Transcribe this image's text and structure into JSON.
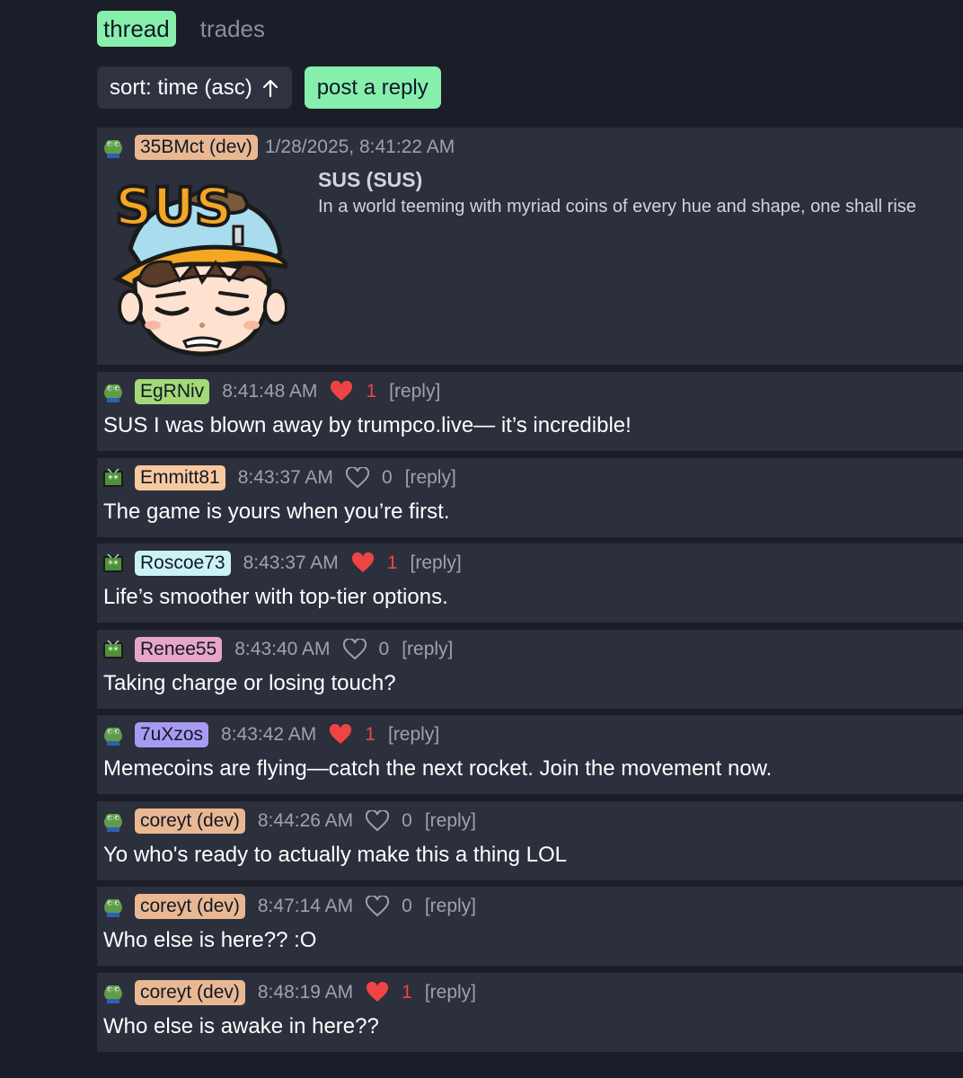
{
  "tabs": {
    "thread": "thread",
    "trades": "trades"
  },
  "controls": {
    "sort_label": "sort: time (asc)",
    "post_reply_label": "post a reply"
  },
  "op": {
    "username": "35BMct (dev)",
    "username_color": "#e9b892",
    "timestamp": "1/28/2025, 8:41:22 AM",
    "image_text": "SUS",
    "coin_title": "SUS (SUS)",
    "description": "In a world teeming with myriad coins of every hue and shape, one shall rise"
  },
  "replies": [
    {
      "username": "EgRNiv",
      "name_color": "#a3d977",
      "avatar": "frog-icon",
      "time": "8:41:48 AM",
      "liked": true,
      "likes": "1",
      "reply": "[reply]",
      "text": "SUS I was blown away by trumpco.live— it’s incredible!"
    },
    {
      "username": "Emmitt81",
      "name_color": "#f8c9a0",
      "avatar": "tv-frog-icon",
      "time": "8:43:37 AM",
      "liked": false,
      "likes": "0",
      "reply": "[reply]",
      "text": "The game is yours when you’re first."
    },
    {
      "username": "Roscoe73",
      "name_color": "#cbf3f5",
      "avatar": "tv-frog-icon",
      "time": "8:43:37 AM",
      "liked": true,
      "likes": "1",
      "reply": "[reply]",
      "text": "Life’s smoother with top-tier options."
    },
    {
      "username": "Renee55",
      "name_color": "#e7a6c9",
      "avatar": "tv-frog-icon",
      "time": "8:43:40 AM",
      "liked": false,
      "likes": "0",
      "reply": "[reply]",
      "text": "Taking charge or losing touch?"
    },
    {
      "username": "7uXzos",
      "name_color": "#a89af1",
      "avatar": "frog-icon",
      "time": "8:43:42 AM",
      "liked": true,
      "likes": "1",
      "reply": "[reply]",
      "text": "Memecoins are flying—catch the next rocket. Join the movement now."
    },
    {
      "username": "coreyt (dev)",
      "name_color": "#e9b892",
      "avatar": "frog-icon",
      "time": "8:44:26 AM",
      "liked": false,
      "likes": "0",
      "reply": "[reply]",
      "text": "Yo who's ready to actually make this a thing LOL"
    },
    {
      "username": "coreyt (dev)",
      "name_color": "#e9b892",
      "avatar": "frog-icon",
      "time": "8:47:14 AM",
      "liked": false,
      "likes": "0",
      "reply": "[reply]",
      "text": "Who else is here?? :O"
    },
    {
      "username": "coreyt (dev)",
      "name_color": "#e9b892",
      "avatar": "frog-icon",
      "time": "8:48:19 AM",
      "liked": true,
      "likes": "1",
      "reply": "[reply]",
      "text": "Who else is awake in here??"
    }
  ]
}
